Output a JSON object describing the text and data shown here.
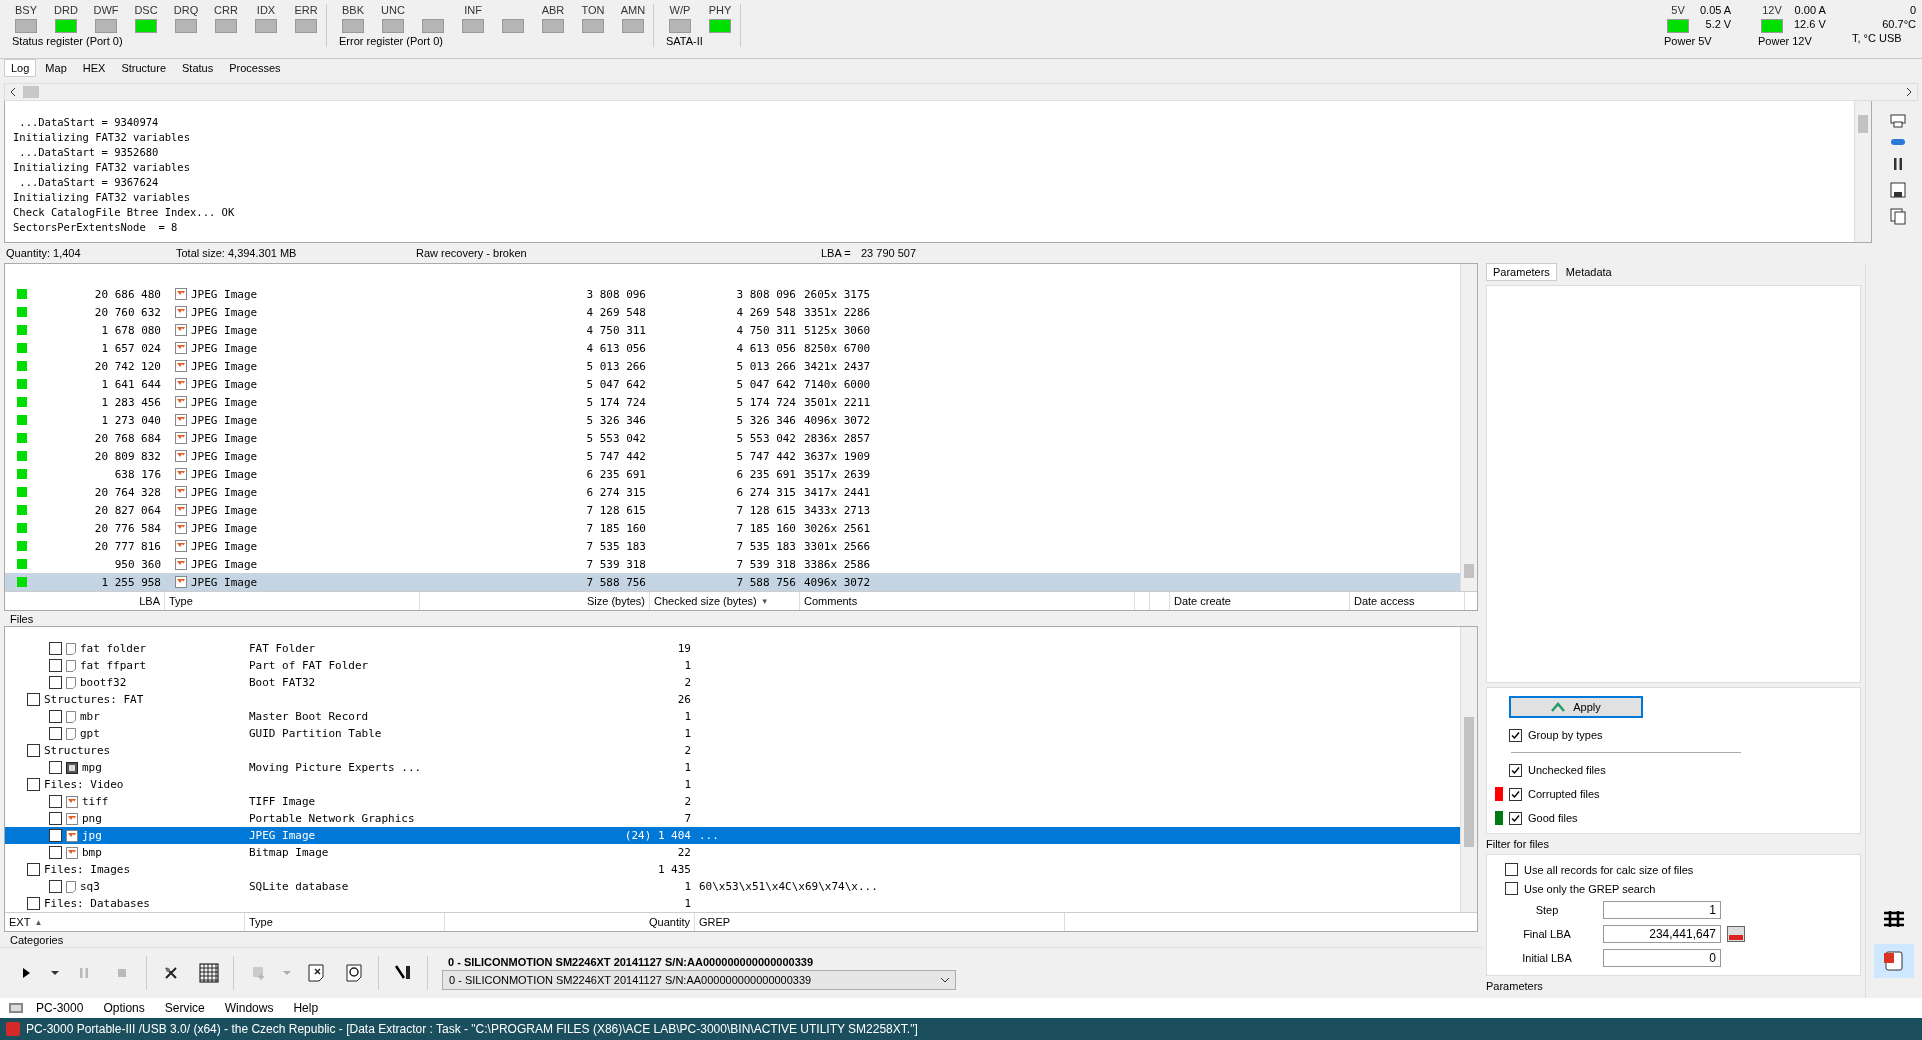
{
  "registers": [
    {
      "title": "Status register (Port 0)",
      "bits": [
        {
          "label": "BSY",
          "on": false
        },
        {
          "label": "DRD",
          "on": true
        },
        {
          "label": "DWF",
          "on": false
        },
        {
          "label": "DSC",
          "on": true
        },
        {
          "label": "DRQ",
          "on": false
        },
        {
          "label": "CRR",
          "on": false
        },
        {
          "label": "IDX",
          "on": false
        },
        {
          "label": "ERR",
          "on": false
        }
      ]
    },
    {
      "title": "Error register (Port 0)",
      "bits": [
        {
          "label": "BBK",
          "on": false
        },
        {
          "label": "UNC",
          "on": false
        },
        {
          "on": false
        },
        {
          "label": "INF",
          "on": false
        },
        {
          "on": false
        },
        {
          "label": "ABR",
          "on": false
        },
        {
          "label": "TON",
          "on": false
        },
        {
          "label": "AMN",
          "on": false
        }
      ]
    },
    {
      "title": "SATA-II",
      "bits": [
        {
          "label": "W/P",
          "on": false
        },
        {
          "label": "PHY",
          "on": true
        }
      ]
    }
  ],
  "power": [
    {
      "title": "Power 5V",
      "label": "5V",
      "on": true,
      "voltage": "5.2 V",
      "current": "0.05 A"
    },
    {
      "title": "Power 12V",
      "label": "12V",
      "on": true,
      "voltage": "12.6 V",
      "current": "0.00 A"
    }
  ],
  "temperature": {
    "usb": "0",
    "value": "60.7°C",
    "title": "T, °C USB"
  },
  "bottom_tabs": [
    {
      "label": "Log",
      "selected": true
    },
    {
      "label": "Map",
      "selected": false
    },
    {
      "label": "HEX",
      "selected": false
    },
    {
      "label": "Structure",
      "selected": false
    },
    {
      "label": "Status",
      "selected": false
    },
    {
      "label": "Processes",
      "selected": false
    }
  ],
  "log": {
    "lines": [
      " ...DataStart = 9340974",
      "Initializing FAT32 variables",
      " ...DataStart = 9352680",
      "Initializing FAT32 variables",
      " ...DataStart = 9367624",
      "Initializing FAT32 variables",
      "Check CatalogFile Btree Index... OK",
      "SectorsPerExtentsNode  = 8"
    ]
  },
  "summary": {
    "quantity": "Quantity: 1,404",
    "total_size": "Total size: 4,394.301 MB",
    "mode": "Raw recovery - broken",
    "lba_label": "LBA =",
    "lba": "23 790 507"
  },
  "files": {
    "label": "Files",
    "rows": [
      {
        "color": "#00dd00",
        "lba": "20 686 480",
        "type": "JPEG Image",
        "size": "3 808 096",
        "checked_size": "3 808 096",
        "comments": "2605x 3175",
        "selected": false
      },
      {
        "color": "#00dd00",
        "lba": "20 760 632",
        "type": "JPEG Image",
        "size": "4 269 548",
        "checked_size": "4 269 548",
        "comments": "3351x 2286",
        "selected": false
      },
      {
        "color": "#00dd00",
        "lba": "1 678 080",
        "type": "JPEG Image",
        "size": "4 750 311",
        "checked_size": "4 750 311",
        "comments": "5125x 3060",
        "selected": false
      },
      {
        "color": "#00dd00",
        "lba": "1 657 024",
        "type": "JPEG Image",
        "size": "4 613 056",
        "checked_size": "4 613 056",
        "comments": "8250x 6700",
        "selected": false
      },
      {
        "color": "#00dd00",
        "lba": "20 742 120",
        "type": "JPEG Image",
        "size": "5 013 266",
        "checked_size": "5 013 266",
        "comments": "3421x 2437",
        "selected": false
      },
      {
        "color": "#00dd00",
        "lba": "1 641 644",
        "type": "JPEG Image",
        "size": "5 047 642",
        "checked_size": "5 047 642",
        "comments": "7140x 6000",
        "selected": false
      },
      {
        "color": "#00dd00",
        "lba": "1 283 456",
        "type": "JPEG Image",
        "size": "5 174 724",
        "checked_size": "5 174 724",
        "comments": "3501x 2211",
        "selected": false
      },
      {
        "color": "#00dd00",
        "lba": "1 273 040",
        "type": "JPEG Image",
        "size": "5 326 346",
        "checked_size": "5 326 346",
        "comments": "4096x 3072",
        "selected": false
      },
      {
        "color": "#00dd00",
        "lba": "20 768 684",
        "type": "JPEG Image",
        "size": "5 553 042",
        "checked_size": "5 553 042",
        "comments": "2836x 2857",
        "selected": false
      },
      {
        "color": "#00dd00",
        "lba": "20 809 832",
        "type": "JPEG Image",
        "size": "5 747 442",
        "checked_size": "5 747 442",
        "comments": "3637x 1909",
        "selected": false
      },
      {
        "color": "#00dd00",
        "lba": "638 176",
        "type": "JPEG Image",
        "size": "6 235 691",
        "checked_size": "6 235 691",
        "comments": "3517x 2639",
        "selected": false
      },
      {
        "color": "#00dd00",
        "lba": "20 764 328",
        "type": "JPEG Image",
        "size": "6 274 315",
        "checked_size": "6 274 315",
        "comments": "3417x 2441",
        "selected": false
      },
      {
        "color": "#00dd00",
        "lba": "20 827 064",
        "type": "JPEG Image",
        "size": "7 128 615",
        "checked_size": "7 128 615",
        "comments": "3433x 2713",
        "selected": false
      },
      {
        "color": "#00dd00",
        "lba": "20 776 584",
        "type": "JPEG Image",
        "size": "7 185 160",
        "checked_size": "7 185 160",
        "comments": "3026x 2561",
        "selected": false
      },
      {
        "color": "#00dd00",
        "lba": "20 777 816",
        "type": "JPEG Image",
        "size": "7 535 183",
        "checked_size": "7 535 183",
        "comments": "3301x 2566",
        "selected": false
      },
      {
        "color": "#00dd00",
        "lba": "950 360",
        "type": "JPEG Image",
        "size": "7 539 318",
        "checked_size": "7 539 318",
        "comments": "3386x 2586",
        "selected": false
      },
      {
        "color": "#00dd00",
        "lba": "1 255 958",
        "type": "JPEG Image",
        "size": "7 588 756",
        "checked_size": "7 588 756",
        "comments": "4096x 3072",
        "selected": true
      }
    ],
    "columns": [
      {
        "label": "LBA"
      },
      {
        "label": "Type"
      },
      {
        "label": "Size (bytes)"
      },
      {
        "label": "Checked size (bytes)",
        "sort_mark": "▼"
      },
      {
        "label": "Comments"
      },
      {},
      {},
      {
        "label": "Date create"
      },
      {
        "label": "Date access"
      }
    ]
  },
  "categories": {
    "rows": [
      {
        "ext": "Structures: FAT",
        "quantity": "26",
        "checked": false,
        "selected": false,
        "children": [
          {
            "kind": "file",
            "ext": "fat folder",
            "type": "FAT Folder",
            "quantity": "19",
            "checked": false,
            "selected": false
          },
          {
            "kind": "file",
            "ext": "fat ffpart",
            "type": "Part of FAT Folder",
            "quantity": "1",
            "checked": false,
            "selected": false
          },
          {
            "kind": "file",
            "ext": "bootf32",
            "type": "Boot FAT32",
            "quantity": "2",
            "checked": false,
            "selected": false
          }
        ]
      },
      {
        "ext": "Structures",
        "quantity": "2",
        "checked": false,
        "selected": false,
        "children": [
          {
            "kind": "file",
            "ext": "mbr",
            "type": "Master Boot Record",
            "quantity": "1",
            "checked": false,
            "selected": false
          },
          {
            "kind": "file",
            "ext": "gpt",
            "type": "GUID Partition Table",
            "quantity": "1",
            "checked": false,
            "selected": false
          }
        ]
      },
      {
        "ext": "Files: Video",
        "quantity": "1",
        "checked": false,
        "selected": false,
        "children": [
          {
            "kind": "video",
            "ext": "mpg",
            "type": "Moving Picture Experts ...",
            "quantity": "1",
            "checked": false,
            "selected": false
          }
        ]
      },
      {
        "ext": "Files: Images",
        "quantity": "1 435",
        "checked": false,
        "selected": false,
        "children": [
          {
            "kind": "image",
            "ext": "tiff",
            "type": "TIFF Image",
            "quantity": "2",
            "checked": false,
            "selected": false
          },
          {
            "kind": "image",
            "ext": "png",
            "type": "Portable Network Graphics",
            "quantity": "7",
            "checked": false,
            "selected": false
          },
          {
            "kind": "image",
            "ext": "jpg",
            "type": "JPEG Image",
            "quantity": "(24) 1 404",
            "grep": "...",
            "checked": false,
            "selected": true
          },
          {
            "kind": "image",
            "ext": "bmp",
            "type": "Bitmap Image",
            "quantity": "22",
            "checked": false,
            "selected": false
          }
        ]
      },
      {
        "ext": "Files: Databases",
        "quantity": "1",
        "checked": false,
        "selected": false,
        "children": [
          {
            "kind": "file",
            "ext": "sq3",
            "type": "SQLite database",
            "quantity": "1",
            "grep": "60\\x53\\x51\\x4C\\x69\\x74\\x...",
            "checked": false,
            "selected": false
          }
        ]
      }
    ],
    "columns": [
      {
        "label": "EXT",
        "sort_mark": "▲"
      },
      {
        "label": "Type"
      },
      {
        "label": "Quantity"
      },
      {
        "label": "GREP"
      }
    ],
    "label": "Categories"
  },
  "toolbar": {
    "buttons": [
      {
        "kind": "play",
        "disabled": false
      },
      {
        "kind": "caret",
        "disabled": false
      },
      {
        "kind": "pause",
        "disabled": true
      },
      {
        "kind": "stop",
        "disabled": true
      },
      {
        "kind": "sep"
      },
      {
        "kind": "tools",
        "disabled": false
      },
      {
        "kind": "grid",
        "disabled": false
      },
      {
        "kind": "sep"
      },
      {
        "kind": "add",
        "disabled": true
      },
      {
        "kind": "caret",
        "disabled": true
      },
      {
        "kind": "doc-x",
        "disabled": false
      },
      {
        "kind": "doc-cycle",
        "disabled": false
      },
      {
        "kind": "sep"
      },
      {
        "kind": "wand",
        "disabled": false
      },
      {
        "kind": "sep"
      }
    ],
    "device_combo": "0 - SILICONMOTION SM2246XT 20141127 S/N:AA000000000000000339",
    "device_label": "0 - SILICONMOTION SM2246XT 20141127 S/N:AA000000000000000339"
  },
  "right_panel": {
    "tabs": [
      {
        "label": "Parameters",
        "selected": true
      },
      {
        "label": "Metadata",
        "selected": false
      }
    ],
    "filter": {
      "apply": "Apply",
      "group_by": {
        "label": "Group by types",
        "checked": true
      },
      "items": [
        {
          "label": "Unchecked files",
          "checked": true
        },
        {
          "label": "Corrupted files",
          "checked": true,
          "color": "#ff0000"
        },
        {
          "label": "Good files",
          "checked": true,
          "color": "#007a12"
        }
      ],
      "title": "Filter for files"
    },
    "parameters": {
      "options": [
        {
          "label": "Use all records for calc size of files",
          "checked": false
        },
        {
          "label": "Use only the GREP search",
          "checked": false
        }
      ],
      "fields": [
        {
          "label": "Step",
          "value": "1"
        },
        {
          "label": "Final LBA",
          "value": "234,441,647"
        },
        {
          "label": "Initial LBA",
          "value": "0"
        }
      ],
      "title": "Parameters"
    }
  },
  "menu": [
    "PC-3000",
    "Options",
    "Service",
    "Windows",
    "Help"
  ],
  "title_bar": {
    "title": "PC-3000 Portable-III /USB 3.0/ (x64) - the Czech Republic - [Data Extractor : Task - \"C:\\PROGRAM FILES (X86)\\ACE LAB\\PC-3000\\BIN\\ACTIVE UTILITY SM2258XT.\"]"
  }
}
